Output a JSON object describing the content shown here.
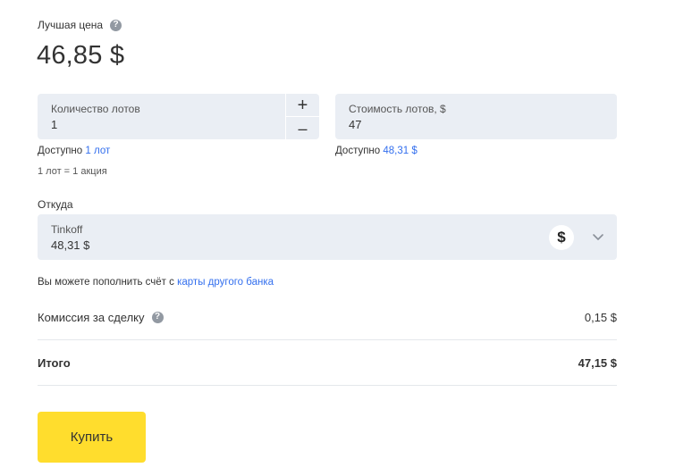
{
  "best_price": {
    "label": "Лучшая цена",
    "value": "46,85 $"
  },
  "lots": {
    "label": "Количество лотов",
    "value": "1",
    "plus": "+",
    "minus": "–",
    "available_prefix": "Доступно",
    "available_value": "1 лот",
    "note": "1 лот = 1 акция"
  },
  "cost": {
    "label": "Стоимость лотов, $",
    "value": "47",
    "available_prefix": "Доступно",
    "available_value": "48,31 $"
  },
  "source": {
    "label": "Откуда",
    "account_name": "Tinkoff",
    "account_balance": "48,31 $",
    "currency_symbol": "$"
  },
  "topup": {
    "text": "Вы можете пополнить счёт с",
    "link": "карты другого банка"
  },
  "commission": {
    "label": "Комиссия за сделку",
    "value": "0,15 $"
  },
  "total": {
    "label": "Итого",
    "value": "47,15 $"
  },
  "buy_button": {
    "label": "Купить"
  },
  "colors": {
    "accent_link": "#336fee",
    "button_yellow": "#ffdd2d",
    "field_bg": "#eaeef4"
  }
}
